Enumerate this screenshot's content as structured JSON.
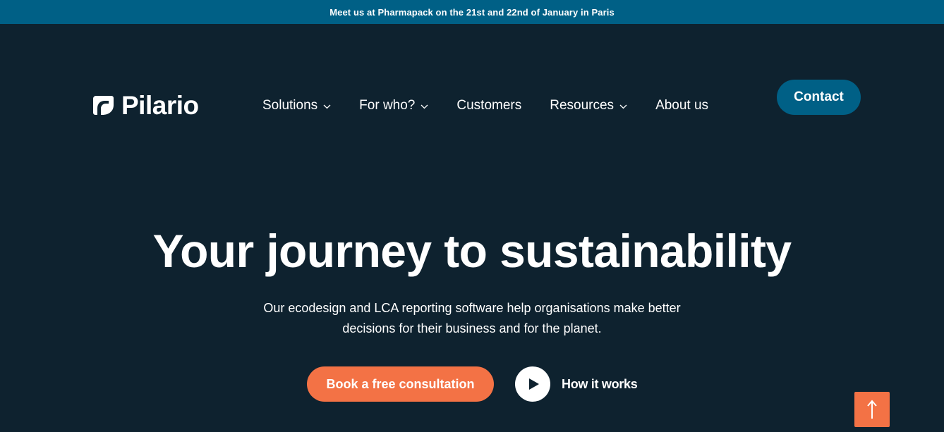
{
  "announcement": {
    "text": "Meet us at Pharmapack on the 21st and 22nd of January in Paris"
  },
  "header": {
    "logo_text": "Pilario",
    "nav": [
      {
        "label": "Solutions",
        "has_dropdown": true
      },
      {
        "label": "For who?",
        "has_dropdown": true
      },
      {
        "label": "Customers",
        "has_dropdown": false
      },
      {
        "label": "Resources",
        "has_dropdown": true
      },
      {
        "label": "About us",
        "has_dropdown": false
      }
    ],
    "contact_label": "Contact"
  },
  "hero": {
    "title": "Your journey to sustainability",
    "subtitle_line1": "Our ecodesign and LCA reporting software help organisations make better",
    "subtitle_line2": "decisions for their business and for the planet.",
    "primary_cta": "Book a free consultation",
    "video_cta": "How it works"
  },
  "icons": {
    "logo": "leaf-logo-icon",
    "dropdown": "chevron-down-icon",
    "play": "play-icon",
    "scroll_top": "arrow-up-icon"
  },
  "colors": {
    "background": "#0e222f",
    "announcement_bar": "#006086",
    "contact_button": "#006086",
    "accent_orange": "#f37245",
    "text": "#ffffff"
  }
}
